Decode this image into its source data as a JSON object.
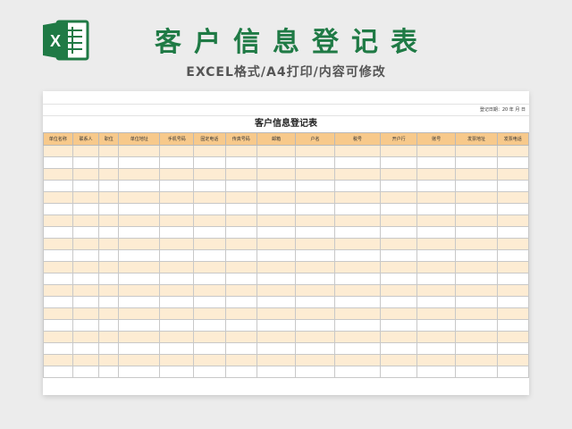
{
  "header": {
    "title": "客户信息登记表",
    "subtitle": "EXCEL格式/A4打印/内容可修改"
  },
  "sheet": {
    "date_label": "登记日期：20 年 月 日",
    "title": "客户信息登记表",
    "columns": [
      "单位名称",
      "联系人",
      "职位",
      "单位地址",
      "手机号码",
      "固定电话",
      "传真号码",
      "邮箱",
      "户名",
      "税号",
      "开户行",
      "账号",
      "发票地址",
      "发票电话"
    ],
    "empty_rows": 20
  },
  "colors": {
    "brand_green": "#1f7a45",
    "header_fill": "#f7c98b",
    "stripe_fill": "#fdecd3"
  }
}
